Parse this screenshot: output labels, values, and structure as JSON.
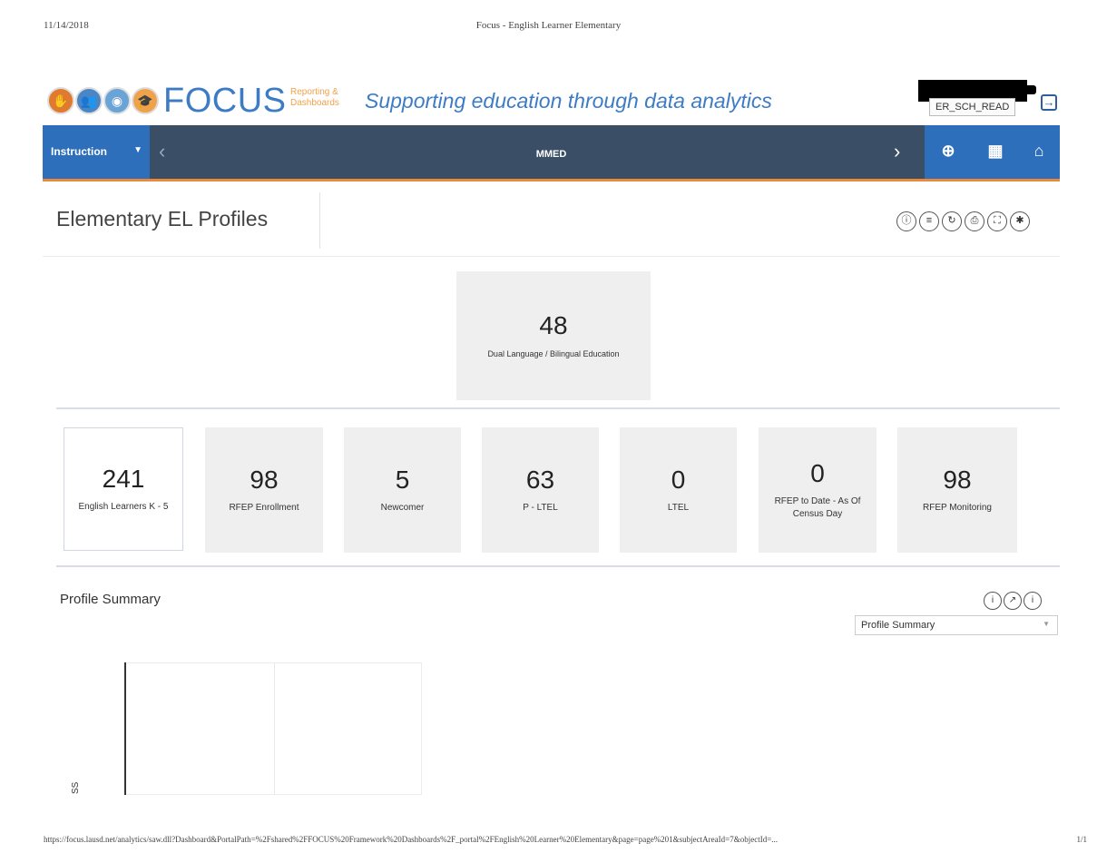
{
  "print": {
    "date": "11/14/2018",
    "title": "Focus - English Learner Elementary",
    "url": "https://focus.lausd.net/analytics/saw.dll?Dashboard&PortalPath=%2Fshared%2FFOCUS%20Framework%20Dashboards%2F_portal%2FEnglish%20Learner%20Elementary&page=page%201&subjectAreaId=7&objectId=...",
    "page": "1/1"
  },
  "brand": {
    "name": "FOCUS",
    "sub_line1": "Reporting &",
    "sub_line2": "Dashboards",
    "tagline": "Supporting education through data analytics",
    "user_role": "ER_SCH_READ"
  },
  "nav": {
    "menu_label": "Instruction",
    "center_title": "MMED",
    "colors": {
      "bar": "#3a4e66",
      "accent": "#2d6fba",
      "underline": "#e88a3a"
    }
  },
  "page": {
    "title": "Elementary EL Profiles"
  },
  "tiles": {
    "featured": {
      "value": "48",
      "label": "Dual Language / Bilingual Education"
    },
    "kpis": [
      {
        "value": "241",
        "label": "English Learners K - 5"
      },
      {
        "value": "98",
        "label": "RFEP Enrollment"
      },
      {
        "value": "5",
        "label": "Newcomer"
      },
      {
        "value": "63",
        "label": "P - LTEL"
      },
      {
        "value": "0",
        "label": "LTEL"
      },
      {
        "value": "0",
        "label": "RFEP to Date - As Of Census Day"
      },
      {
        "value": "98",
        "label": "RFEP Monitoring"
      }
    ]
  },
  "summary": {
    "title": "Profile Summary",
    "selected_view": "Profile Summary",
    "axis_label": "SS"
  }
}
